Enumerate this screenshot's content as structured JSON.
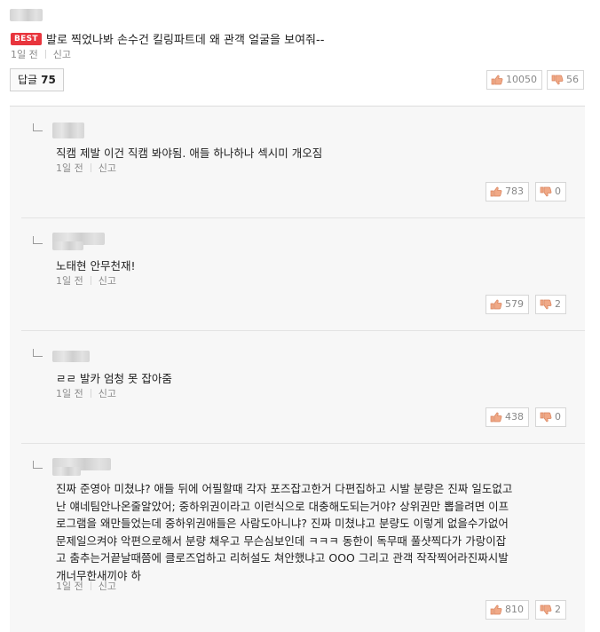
{
  "best_comment": {
    "badge": "BEST",
    "text": "발로 찍었나봐 손수건 킬링파트데 왜 관객 얼굴을 보여줘--",
    "time": "1일 전",
    "report": "신고",
    "upvotes": "10050",
    "downvotes": "56"
  },
  "reply_button": {
    "label": "답글",
    "count": "75"
  },
  "replies": [
    {
      "text": "직캠 제발 이건 직캠 봐야됨. 애들 하나하나 섹시미 개오짐",
      "time": "1일 전",
      "report": "신고",
      "upvotes": "783",
      "downvotes": "0"
    },
    {
      "text": "노태현 안무천재!",
      "time": "1일 전",
      "report": "신고",
      "upvotes": "579",
      "downvotes": "2"
    },
    {
      "text": "ㄹㄹ 발카 엄청 못 잡아줌",
      "time": "1일 전",
      "report": "신고",
      "upvotes": "438",
      "downvotes": "0"
    },
    {
      "lines": [
        "진짜 준영아 미쳤냐? 애들 뒤에 어필할때 각자 포즈잡고한거 다편집하고 시발 분량은 진짜 일도없고",
        "난 얘네팀안나온줄알았어; 중하위권이라고 이런식으로 대충해도되는거야? 상위권만 뽑을려면 이프",
        "로그램을 왜만들었는데 중하위권애들은 사람도아니냐? 진짜 미쳤냐고 분량도 이렇게 없을수가없어",
        "문제일으켜야 악편으로해서 분량 채우고 무슨심보인데 ㅋㅋㅋ 동한이 독무때 풀샷찍다가 가랑이잡",
        "고 춤추는거끝날때쯤에 클로즈업하고 리허설도 쳐안했냐고 OOO 그리고 관객 작작찍어라진짜시발",
        "개너무한새끼야 하"
      ],
      "time": "1일 전",
      "report": "신고",
      "upvotes": "810",
      "downvotes": "2"
    }
  ]
}
